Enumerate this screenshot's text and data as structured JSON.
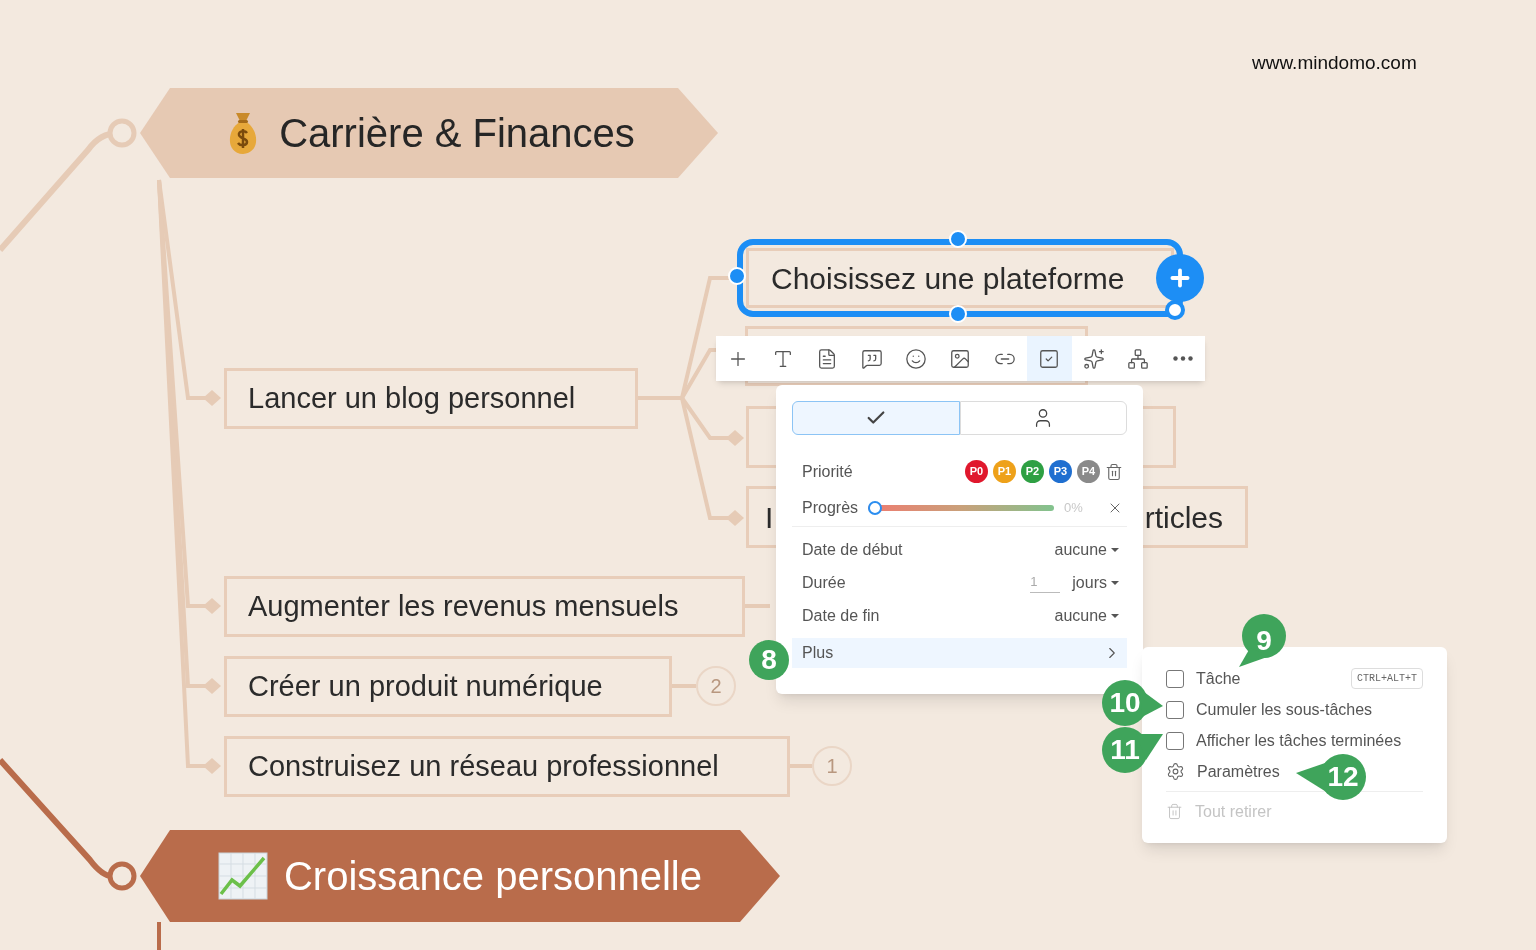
{
  "site_label": "www.mindomo.com",
  "main_topics": [
    {
      "label": "Carrière & Finances",
      "kind": "light"
    },
    {
      "label": "Croissance personnelle",
      "kind": "dark"
    }
  ],
  "subtopics": [
    {
      "label": "Lancer un blog personnel"
    },
    {
      "label": "Augmenter les revenus mensuels"
    },
    {
      "label": "Créer un produit numérique",
      "badge": "2"
    },
    {
      "label": "Construisez un réseau professionnel",
      "badge": "1"
    }
  ],
  "blog_children": [
    {
      "fragments": [
        "Choisissez une plateforme"
      ],
      "selected": true
    },
    {
      "selected": false
    },
    {
      "selected": false
    },
    {
      "fragments": [
        "I",
        "rticles"
      ],
      "selected": false
    }
  ],
  "toolbar": {
    "tools": [
      {
        "kind": "add",
        "selected": false
      },
      {
        "kind": "text",
        "selected": false
      },
      {
        "kind": "note",
        "selected": false
      },
      {
        "kind": "comment",
        "selected": false
      },
      {
        "kind": "emoji",
        "selected": false
      },
      {
        "kind": "image",
        "selected": false
      },
      {
        "kind": "link",
        "selected": false
      },
      {
        "kind": "task",
        "selected": true
      },
      {
        "kind": "ai",
        "selected": false
      },
      {
        "kind": "structure",
        "selected": false
      },
      {
        "kind": "more",
        "selected": false
      }
    ]
  },
  "task_panel": {
    "tabs": [
      {
        "kind": "task",
        "selected": true
      },
      {
        "kind": "assignee",
        "selected": false
      }
    ],
    "priority": {
      "label": "Priorité",
      "options": [
        {
          "label": "P0",
          "color": "#e0182d"
        },
        {
          "label": "P1",
          "color": "#eea11a"
        },
        {
          "label": "P2",
          "color": "#2ea043"
        },
        {
          "label": "P3",
          "color": "#1f6fd0"
        },
        {
          "label": "P4",
          "color": "#8a8a8a"
        }
      ]
    },
    "progress": {
      "label": "Progrès",
      "level": 0,
      "reading": "0%"
    },
    "fields": [
      {
        "kind": "dropdown",
        "label": "Date de début",
        "value": "aucune"
      },
      {
        "kind": "number",
        "label": "Durée",
        "placeholder": "1",
        "unit": "jours"
      },
      {
        "kind": "dropdown",
        "label": "Date de fin",
        "value": "aucune"
      }
    ],
    "more": {
      "label": "Plus",
      "selected": true
    }
  },
  "more_menu": {
    "items": [
      {
        "kind": "checkbox",
        "label": "Tâche",
        "checked": false,
        "shortcut": "CTRL+ALT+T",
        "disabled": false
      },
      {
        "kind": "checkbox",
        "label": "Cumuler les sous-tâches",
        "checked": false,
        "disabled": false
      },
      {
        "kind": "checkbox",
        "label": "Afficher les tâches terminées",
        "checked": false,
        "disabled": false
      },
      {
        "kind": "settings",
        "label": "Paramètres",
        "disabled": false
      },
      {
        "kind": "remove",
        "label": "Tout retirer",
        "disabled": true
      }
    ]
  },
  "callouts": [
    {
      "label": "8"
    },
    {
      "label": "9"
    },
    {
      "label": "10"
    },
    {
      "label": "11"
    },
    {
      "label": "12"
    }
  ]
}
